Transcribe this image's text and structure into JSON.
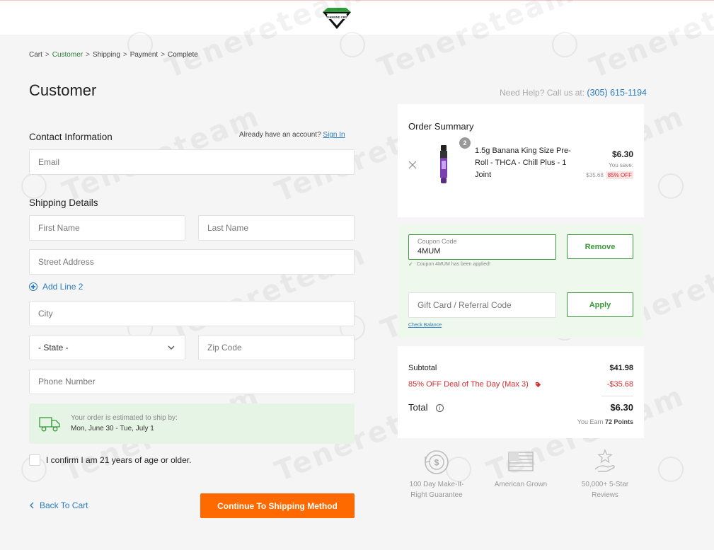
{
  "header": {
    "logo_text": "DIAMOND CBD"
  },
  "watermark": {
    "text": "Tenereteam"
  },
  "breadcrumb": {
    "items": [
      {
        "label": "Cart",
        "active": false
      },
      {
        "label": "Customer",
        "active": true
      },
      {
        "label": "Shipping",
        "active": false
      },
      {
        "label": "Payment",
        "active": false
      },
      {
        "label": "Complete",
        "active": false
      }
    ],
    "separator": ">"
  },
  "page": {
    "title": "Customer",
    "help_prefix": "Need Help? Call us at:",
    "help_phone": "(305) 615-1194"
  },
  "contact": {
    "title": "Contact Information",
    "account_prompt": "Already have an account?",
    "sign_in": "Sign In",
    "email_placeholder": "Email"
  },
  "shipping": {
    "title": "Shipping Details",
    "first_name": "First Name",
    "last_name": "Last Name",
    "street": "Street Address",
    "add_line": "Add Line 2",
    "city": "City",
    "state": "- State -",
    "zip": "Zip Code",
    "phone": "Phone Number",
    "estimate_label": "Your order is estimated to ship by:",
    "estimate_dates": "Mon, June 30 - Tue, July 1"
  },
  "age_confirm": "I confirm I am 21 years of age or older.",
  "nav": {
    "back": "Back To Cart",
    "continue": "Continue To Shipping Method"
  },
  "summary": {
    "title": "Order Summary",
    "item": {
      "quantity": "2",
      "name": "1.5g Banana King Size Pre-Roll - THCA - Chill Plus - 1 Joint",
      "price": "$6.30",
      "you_save_label": "You save:",
      "original_price": "$35.68",
      "discount_badge": "85% OFF"
    }
  },
  "coupon": {
    "label": "Coupon Code",
    "value": "4MUM",
    "remove": "Remove",
    "applied_message": "Coupon 4MUM has been applied!"
  },
  "gift": {
    "placeholder": "Gift Card / Referral Code",
    "apply": "Apply",
    "check_balance": "Check Balance"
  },
  "totals": {
    "subtotal_label": "Subtotal",
    "subtotal_value": "$41.98",
    "deal_label": "85% OFF Deal of The Day (Max 3)",
    "deal_value": "-$35.68",
    "total_label": "Total",
    "total_value": "$6.30",
    "earn_prefix": "You Earn",
    "earn_points": "72 Points"
  },
  "badges": [
    {
      "line1": "100 Day Make-It-",
      "line2": "Right Guarantee",
      "icon": "money-back-icon"
    },
    {
      "line1": "American Grown",
      "line2": "",
      "icon": "us-flag-icon"
    },
    {
      "line1": "50,000+ 5-Star",
      "line2": "Reviews",
      "icon": "star-hand-icon"
    }
  ],
  "colors": {
    "accent_orange": "#ff6a00",
    "link_blue": "#2a7ec0",
    "success_green": "#3a9a3a",
    "discount_red": "#d32f2f",
    "panel_green": "#eef8ec"
  }
}
